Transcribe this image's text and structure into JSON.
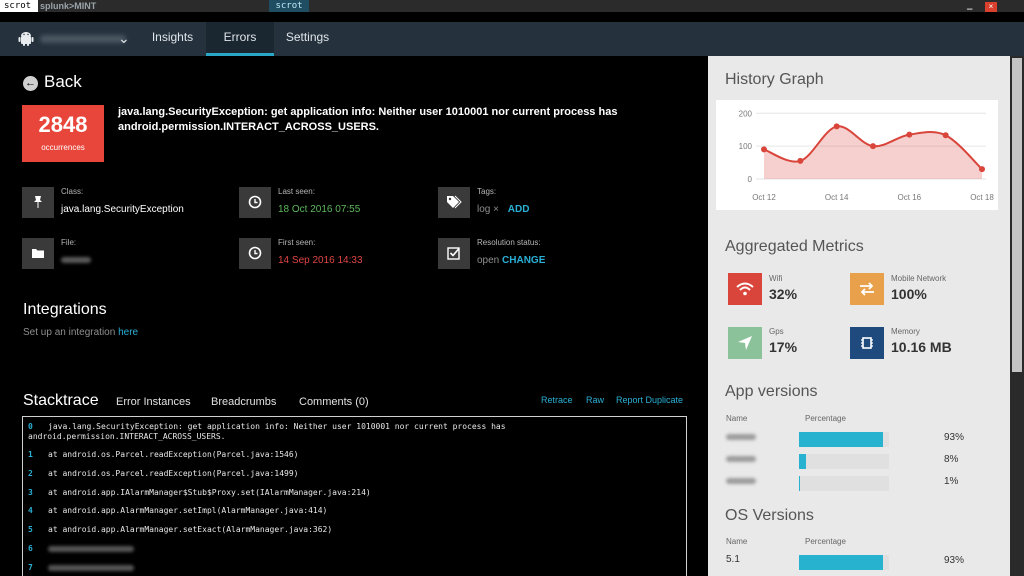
{
  "topbar": {
    "input_text": "scrot",
    "brand": "splunk>MINT",
    "tab_label": "scrot",
    "close_glyph": "×",
    "minimize_glyph": "▁"
  },
  "nav": {
    "tabs": [
      {
        "label": "Insights"
      },
      {
        "label": "Errors"
      },
      {
        "label": "Settings"
      }
    ],
    "active_tab": "Errors",
    "chevron": "⌄"
  },
  "error": {
    "back_label": "Back",
    "back_icon": "←",
    "occurrences": "2848",
    "occurrences_label": "occurrences",
    "title": "java.lang.SecurityException: get application info: Neither user 1010001 nor current process has android.permission.INTERACT_ACROSS_USERS."
  },
  "meta": {
    "class_label": "Class:",
    "class_value": "java.lang.SecurityException",
    "last_seen_label": "Last seen:",
    "last_seen_value": "18 Oct 2016 07:55",
    "tags_label": "Tags:",
    "tag_name": "log",
    "tag_remove": "×",
    "tag_add": "ADD",
    "file_label": "File:",
    "first_seen_label": "First seen:",
    "first_seen_value": "14 Sep 2016 14:33",
    "resolution_label": "Resolution status:",
    "resolution_value": "open",
    "resolution_change": "CHANGE",
    "icons": {
      "class": "pin-icon",
      "last_seen": "clock-icon",
      "tags": "tag-icon",
      "file": "folder-icon",
      "first_seen": "clock-icon",
      "resolution": "checkbox-icon"
    }
  },
  "integrations": {
    "title": "Integrations",
    "text": "Set up an integration",
    "link": "here"
  },
  "stacktrace": {
    "title": "Stacktrace",
    "tabs": [
      "Error Instances",
      "Breadcrumbs",
      "Comments (0)"
    ],
    "actions": [
      "Retrace",
      "Raw",
      "Report Duplicate"
    ],
    "lines": [
      {
        "num": "0",
        "text": "java.lang.SecurityException: get application info: Neither user 1010001 nor current process has android.permission.INTERACT_ACROSS_USERS."
      },
      {
        "num": "1",
        "text": "at android.os.Parcel.readException(Parcel.java:1546)"
      },
      {
        "num": "2",
        "text": "at android.os.Parcel.readException(Parcel.java:1499)"
      },
      {
        "num": "3",
        "text": "at android.app.IAlarmManager$Stub$Proxy.set(IAlarmManager.java:214)"
      },
      {
        "num": "4",
        "text": "at android.app.AlarmManager.setImpl(AlarmManager.java:414)"
      },
      {
        "num": "5",
        "text": "at android.app.AlarmManager.setExact(AlarmManager.java:362)"
      },
      {
        "num": "6",
        "text": ""
      },
      {
        "num": "7",
        "text": ""
      }
    ]
  },
  "history": {
    "title": "History Graph"
  },
  "metrics": {
    "title": "Aggregated Metrics",
    "items": [
      {
        "label": "Wifi",
        "value": "32%",
        "icon": "wifi-icon",
        "color": "#d9453b"
      },
      {
        "label": "Mobile Network",
        "value": "100%",
        "icon": "arrows-icon",
        "color": "#e9a04a"
      },
      {
        "label": "Gps",
        "value": "17%",
        "icon": "location-icon",
        "color": "#8cc29a"
      },
      {
        "label": "Memory",
        "value": "10.16 MB",
        "icon": "chip-icon",
        "color": "#1e4a7e"
      }
    ]
  },
  "app_versions": {
    "title": "App versions",
    "name_header": "Name",
    "percent_header": "Percentage",
    "rows": [
      {
        "name": "",
        "percent": "93%",
        "fraction": 0.93
      },
      {
        "name": "",
        "percent": "8%",
        "fraction": 0.08
      },
      {
        "name": "",
        "percent": "1%",
        "fraction": 0.01
      }
    ]
  },
  "os_versions": {
    "title": "OS Versions",
    "name_header": "Name",
    "percent_header": "Percentage",
    "rows": [
      {
        "name": "5.1",
        "percent": "93%",
        "fraction": 0.93
      }
    ]
  },
  "chart_data": {
    "type": "area",
    "title": "",
    "xlabel": "",
    "ylabel": "",
    "x": [
      "Oct 12",
      "Oct 13",
      "Oct 14",
      "Oct 15",
      "Oct 16",
      "Oct 17",
      "Oct 18"
    ],
    "x_tick_labels": [
      "Oct 12",
      "Oct 14",
      "Oct 16",
      "Oct 18"
    ],
    "y_ticks": [
      "0",
      "100",
      "200"
    ],
    "ylim": [
      0,
      210
    ],
    "series": [
      {
        "values": [
          90,
          55,
          160,
          100,
          135,
          133,
          30
        ],
        "color": "#d9453b"
      }
    ],
    "grid": true,
    "legend": "none"
  }
}
